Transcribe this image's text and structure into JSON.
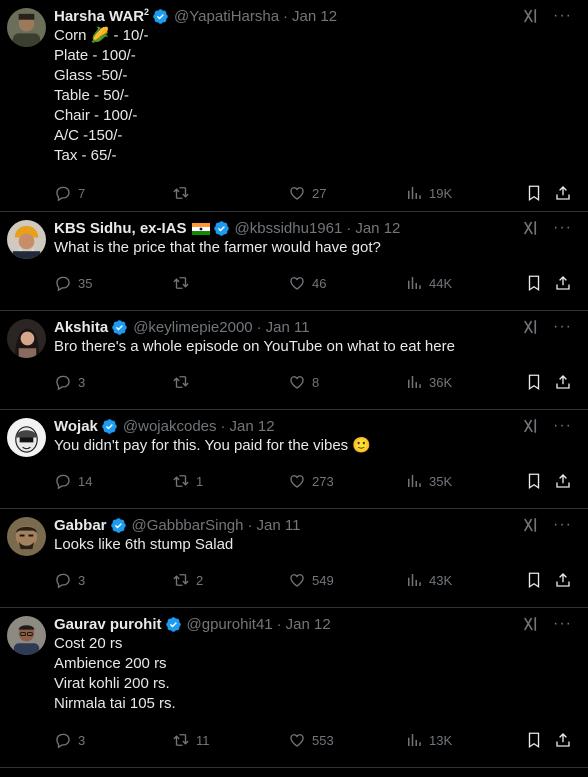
{
  "tweets": [
    {
      "name": "Harsha WAR",
      "name_sup": "2",
      "handle": "@YapatiHarsha",
      "time": "Jan 12",
      "lines": [
        "Corn 🌽 - 10/-",
        "Plate - 100/-",
        "Glass -50/-",
        "Table - 50/-",
        "Chair - 100/-",
        "A/C -150/-",
        "Tax - 65/-"
      ],
      "replies": "7",
      "retweets": "",
      "likes": "27",
      "views": "19K"
    },
    {
      "name": "KBS Sidhu, ex-IAS",
      "handle": "@kbssidhu1961",
      "time": "Jan 12",
      "lines": [
        "What is the price that the farmer would have got?"
      ],
      "replies": "35",
      "retweets": "",
      "likes": "46",
      "views": "44K"
    },
    {
      "name": "Akshita",
      "handle": "@keylimepie2000",
      "time": "Jan 11",
      "lines": [
        "Bro there's a whole episode on YouTube on what to eat here"
      ],
      "replies": "3",
      "retweets": "",
      "likes": "8",
      "views": "36K"
    },
    {
      "name": "Wojak",
      "handle": "@wojakcodes",
      "time": "Jan 12",
      "lines": [
        "You didn't pay for this. You paid for the vibes 🙂"
      ],
      "replies": "14",
      "retweets": "1",
      "likes": "273",
      "views": "35K"
    },
    {
      "name": "Gabbar",
      "handle": "@GabbbarSingh",
      "time": "Jan 11",
      "lines": [
        "Looks like 6th stump Salad"
      ],
      "replies": "3",
      "retweets": "2",
      "likes": "549",
      "views": "43K"
    },
    {
      "name": "Gaurav purohit",
      "handle": "@gpurohit41",
      "time": "Jan 12",
      "lines": [
        "Cost 20 rs",
        "Ambience 200 rs",
        "Virat kohli 200 rs.",
        "Nirmala tai 105 rs."
      ],
      "replies": "3",
      "retweets": "11",
      "likes": "553",
      "views": "13K"
    }
  ],
  "separator": "·",
  "more_glyph": "···",
  "colors": {
    "background": "#000000",
    "text": "#e7e9ea",
    "muted": "#71767b",
    "verified": "#1d9bf0",
    "divider": "#2f3336"
  },
  "icons": [
    "verified-badge-icon",
    "grok-icon",
    "more-icon",
    "reply-icon",
    "retweet-icon",
    "like-icon",
    "views-icon",
    "bookmark-icon",
    "share-icon",
    "india-flag-icon"
  ]
}
